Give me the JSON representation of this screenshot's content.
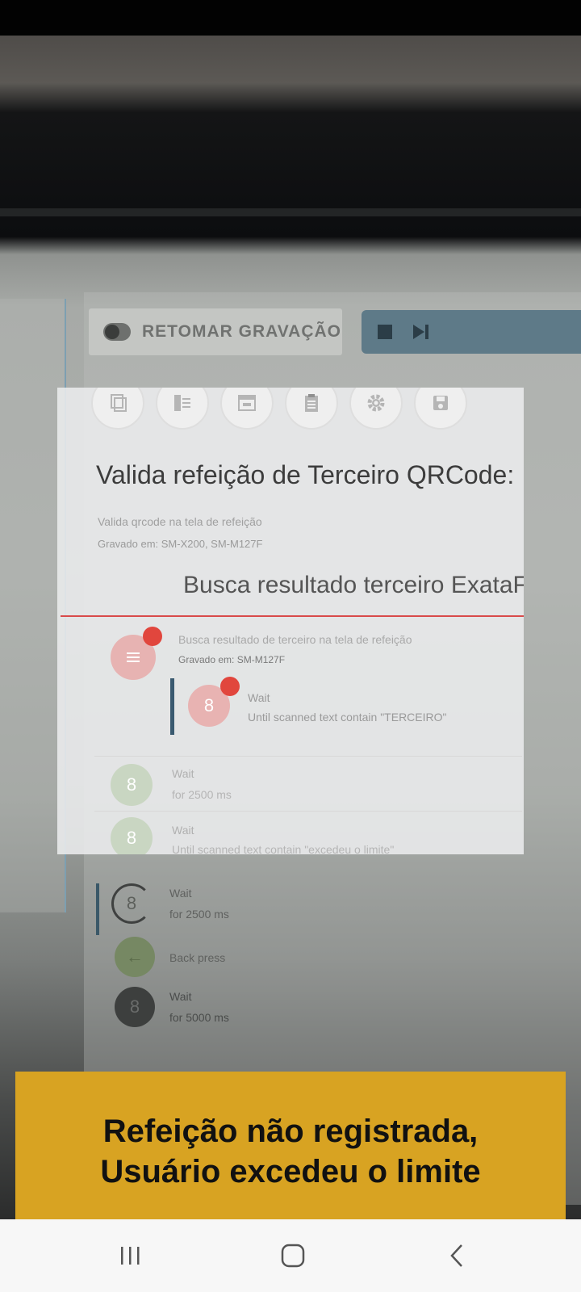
{
  "recorder": {
    "resume_label": "RETOMAR GRAVAÇÃO"
  },
  "toolbar_icons": [
    "copy-icon",
    "list-add-icon",
    "window-icon",
    "clipboard-icon",
    "gear-icon",
    "save-icon"
  ],
  "scan": {
    "title": "Valida refeição de Terceiro QRCode:",
    "description": "Valida qrcode na tela de refeição",
    "recorded_on": "Gravado em: SM-X200, SM-M127F",
    "subtitle": "Busca resultado terceiro ExataFace",
    "step": {
      "title": "Busca resultado de terceiro na tela de refeição",
      "recorded_on": "Gravado em: SM-M127F",
      "wait_title": "Wait",
      "wait_sub": "Until scanned text contain \"TERCEIRO\""
    },
    "rows": [
      {
        "title": "Wait",
        "subtitle": "for 2500 ms"
      },
      {
        "title": "Wait",
        "subtitle": "Until scanned text contain \"excedeu o limite\""
      }
    ]
  },
  "background_steps": [
    {
      "title": "Wait",
      "subtitle": "for 2500 ms"
    },
    {
      "title": "Back press",
      "subtitle": ""
    },
    {
      "title": "Wait",
      "subtitle": "for 5000 ms"
    }
  ],
  "toast": {
    "line1": "Refeição não registrada,",
    "line2": "Usuário excedeu o limite"
  },
  "navbar": {
    "recents_icon": "recents-icon",
    "home_icon": "home-icon",
    "back_icon": "back-icon"
  }
}
